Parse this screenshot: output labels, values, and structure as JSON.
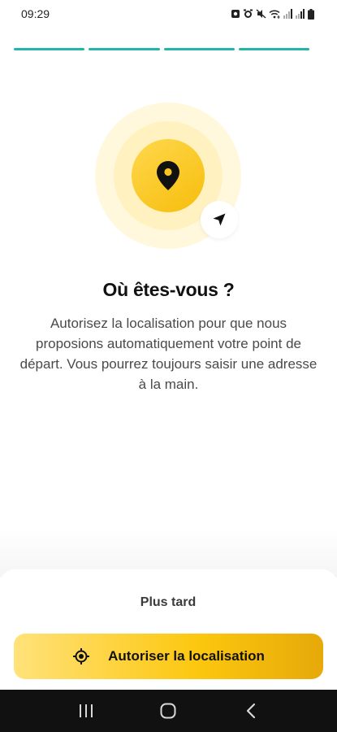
{
  "status_bar": {
    "time": "09:29",
    "icons": [
      "screenshot-icon",
      "alarm-icon",
      "mute-icon",
      "wifi-icon",
      "signal-icon",
      "signal-icon-2",
      "battery-icon"
    ]
  },
  "progress": {
    "steps_total": 4,
    "steps_done": 4,
    "color": "#23b5a6"
  },
  "hero": {
    "icon": "location-pin-icon",
    "badge_icon": "navigation-arrow-icon"
  },
  "content": {
    "title": "Où êtes-vous ?",
    "description": "Autorisez la localisation pour que nous proposions automatiquement votre point de départ. Vous pourrez toujours saisir une adresse à la main."
  },
  "actions": {
    "later_label": "Plus tard",
    "allow_label": "Autoriser la localisation",
    "allow_icon": "crosshair-icon"
  },
  "colors": {
    "accent": "#fcc70e",
    "progress": "#23b5a6"
  },
  "system_nav": {
    "icons": [
      "recents-icon",
      "home-icon",
      "back-icon"
    ]
  }
}
